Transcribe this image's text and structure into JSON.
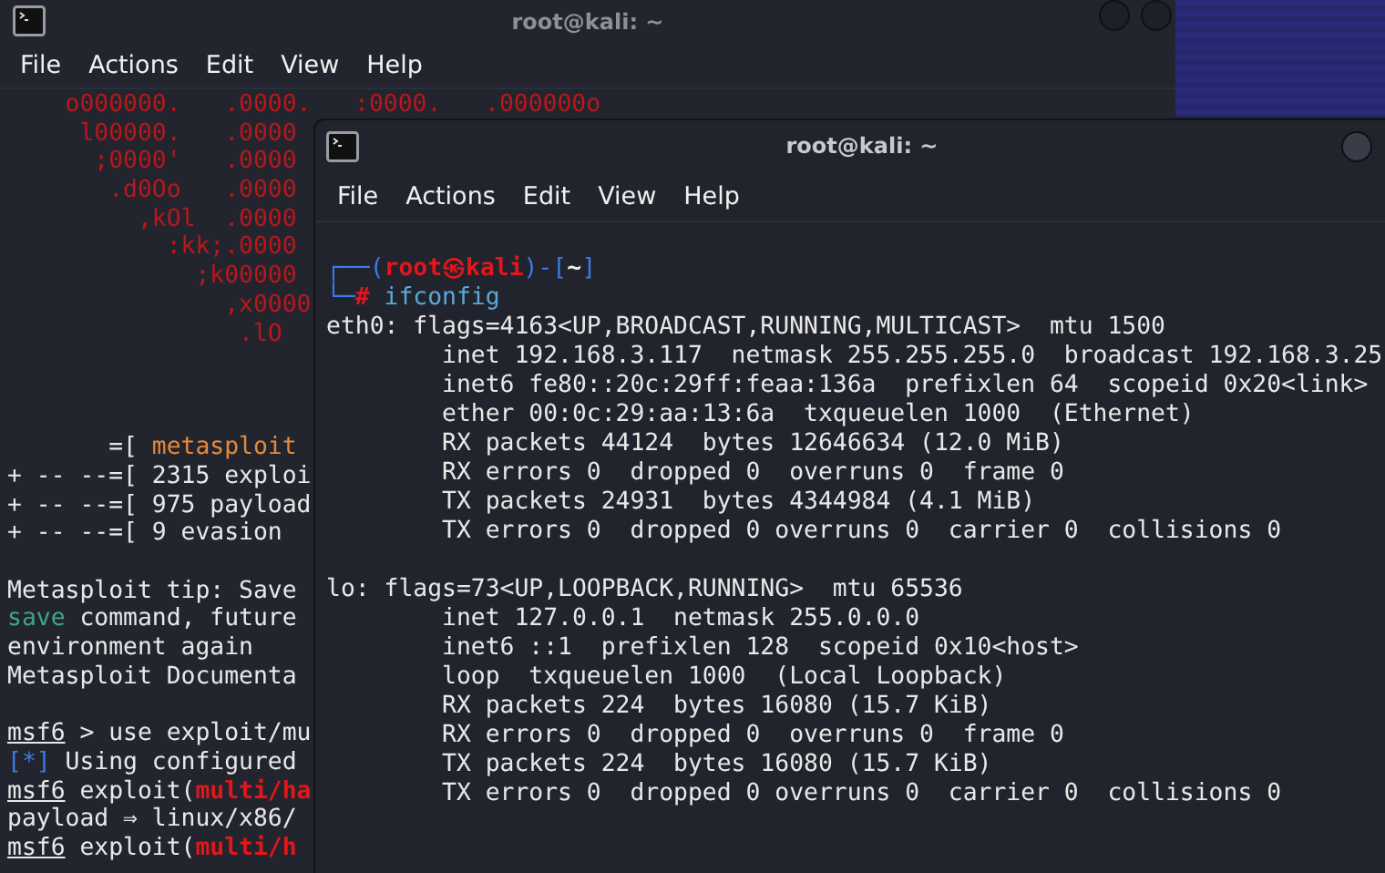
{
  "back_window": {
    "title": "root@kali: ~",
    "menu": [
      "File",
      "Actions",
      "Edit",
      "View",
      "Help"
    ],
    "lines": [
      {
        "kind": "text",
        "segments": [
          {
            "text": "    o000000.   .0000.   :0000.   .000000o",
            "kind": "logo"
          }
        ]
      },
      {
        "kind": "text",
        "segments": [
          {
            "text": "     l00000.   .0000",
            "kind": "logo"
          }
        ]
      },
      {
        "kind": "text",
        "segments": [
          {
            "text": "      ;0000'   .0000",
            "kind": "logo"
          }
        ]
      },
      {
        "kind": "text",
        "segments": [
          {
            "text": "       .d0Oo   .0000",
            "kind": "logo"
          }
        ]
      },
      {
        "kind": "text",
        "segments": [
          {
            "text": "         ,kOl  .0000",
            "kind": "logo"
          }
        ]
      },
      {
        "kind": "text",
        "segments": [
          {
            "text": "           :kk;.0000",
            "kind": "logo"
          }
        ]
      },
      {
        "kind": "text",
        "segments": [
          {
            "text": "             ;k00000",
            "kind": "logo"
          }
        ]
      },
      {
        "kind": "text",
        "segments": [
          {
            "text": "               ,x0000",
            "kind": "logo"
          }
        ]
      },
      {
        "kind": "text",
        "segments": [
          {
            "text": "                .lO",
            "kind": "logo"
          }
        ]
      },
      {
        "kind": "blank"
      },
      {
        "kind": "blank"
      },
      {
        "kind": "blank"
      },
      {
        "kind": "text",
        "segments": [
          {
            "text": "       =[ ",
            "kind": "plain"
          },
          {
            "text": "metasploit",
            "kind": "orange"
          }
        ]
      },
      {
        "kind": "text",
        "segments": [
          {
            "text": "+ -- --=[ 2315 exploi",
            "kind": "plain"
          }
        ]
      },
      {
        "kind": "text",
        "segments": [
          {
            "text": "+ -- --=[ 975 payload",
            "kind": "plain"
          }
        ]
      },
      {
        "kind": "text",
        "segments": [
          {
            "text": "+ -- --=[ 9 evasion",
            "kind": "plain"
          }
        ]
      },
      {
        "kind": "blank"
      },
      {
        "kind": "text",
        "segments": [
          {
            "text": "Metasploit tip: Save",
            "kind": "plain"
          }
        ]
      },
      {
        "kind": "text",
        "segments": [
          {
            "text": "save",
            "kind": "green"
          },
          {
            "text": " command, future",
            "kind": "plain"
          }
        ]
      },
      {
        "kind": "text",
        "segments": [
          {
            "text": "environment again",
            "kind": "plain"
          }
        ]
      },
      {
        "kind": "text",
        "segments": [
          {
            "text": "Metasploit Documenta",
            "kind": "plain"
          }
        ]
      },
      {
        "kind": "blank"
      },
      {
        "kind": "text",
        "segments": [
          {
            "text": "msf6",
            "kind": "underline"
          },
          {
            "text": " > use exploit/mu",
            "kind": "plain"
          }
        ]
      },
      {
        "kind": "text",
        "segments": [
          {
            "text": "[*]",
            "kind": "blue"
          },
          {
            "text": " Using configured",
            "kind": "plain"
          }
        ]
      },
      {
        "kind": "text",
        "segments": [
          {
            "text": "msf6",
            "kind": "underline"
          },
          {
            "text": " exploit(",
            "kind": "plain"
          },
          {
            "text": "multi/ha",
            "kind": "red-bold"
          }
        ]
      },
      {
        "kind": "text",
        "segments": [
          {
            "text": "payload ⇒ linux/x86/",
            "kind": "plain"
          }
        ]
      },
      {
        "kind": "text",
        "segments": [
          {
            "text": "msf6",
            "kind": "underline"
          },
          {
            "text": " exploit(",
            "kind": "plain"
          },
          {
            "text": "multi/h",
            "kind": "red-bold"
          }
        ]
      }
    ]
  },
  "front_window": {
    "title": "root@kali: ~",
    "menu": [
      "File",
      "Actions",
      "Edit",
      "View",
      "Help"
    ],
    "lines": [
      {
        "kind": "text",
        "segments": [
          {
            "text": "┌──(",
            "kind": "blue"
          },
          {
            "text": "root㉿kali",
            "kind": "red-bold"
          },
          {
            "text": ")-[",
            "kind": "blue"
          },
          {
            "text": "~",
            "kind": "white-bold"
          },
          {
            "text": "]",
            "kind": "blue"
          }
        ]
      },
      {
        "kind": "text",
        "segments": [
          {
            "text": "└─",
            "kind": "blue"
          },
          {
            "text": "#",
            "kind": "red-bold"
          },
          {
            "text": " ifconfig",
            "kind": "cyan"
          }
        ]
      },
      {
        "kind": "text",
        "segments": [
          {
            "text": "eth0: flags=4163<UP,BROADCAST,RUNNING,MULTICAST>  mtu 1500",
            "kind": "plain"
          }
        ]
      },
      {
        "kind": "text",
        "segments": [
          {
            "text": "        inet 192.168.3.117  netmask 255.255.255.0  broadcast 192.168.3.25",
            "kind": "plain"
          }
        ]
      },
      {
        "kind": "text",
        "segments": [
          {
            "text": "        inet6 fe80::20c:29ff:feaa:136a  prefixlen 64  scopeid 0x20<link>",
            "kind": "plain"
          }
        ]
      },
      {
        "kind": "text",
        "segments": [
          {
            "text": "        ether 00:0c:29:aa:13:6a  txqueuelen 1000  (Ethernet)",
            "kind": "plain"
          }
        ]
      },
      {
        "kind": "text",
        "segments": [
          {
            "text": "        RX packets 44124  bytes 12646634 (12.0 MiB)",
            "kind": "plain"
          }
        ]
      },
      {
        "kind": "text",
        "segments": [
          {
            "text": "        RX errors 0  dropped 0  overruns 0  frame 0",
            "kind": "plain"
          }
        ]
      },
      {
        "kind": "text",
        "segments": [
          {
            "text": "        TX packets 24931  bytes 4344984 (4.1 MiB)",
            "kind": "plain"
          }
        ]
      },
      {
        "kind": "text",
        "segments": [
          {
            "text": "        TX errors 0  dropped 0 overruns 0  carrier 0  collisions 0",
            "kind": "plain"
          }
        ]
      },
      {
        "kind": "blank"
      },
      {
        "kind": "text",
        "segments": [
          {
            "text": "lo: flags=73<UP,LOOPBACK,RUNNING>  mtu 65536",
            "kind": "plain"
          }
        ]
      },
      {
        "kind": "text",
        "segments": [
          {
            "text": "        inet 127.0.0.1  netmask 255.0.0.0",
            "kind": "plain"
          }
        ]
      },
      {
        "kind": "text",
        "segments": [
          {
            "text": "        inet6 ::1  prefixlen 128  scopeid 0x10<host>",
            "kind": "plain"
          }
        ]
      },
      {
        "kind": "text",
        "segments": [
          {
            "text": "        loop  txqueuelen 1000  (Local Loopback)",
            "kind": "plain"
          }
        ]
      },
      {
        "kind": "text",
        "segments": [
          {
            "text": "        RX packets 224  bytes 16080 (15.7 KiB)",
            "kind": "plain"
          }
        ]
      },
      {
        "kind": "text",
        "segments": [
          {
            "text": "        RX errors 0  dropped 0  overruns 0  frame 0",
            "kind": "plain"
          }
        ]
      },
      {
        "kind": "text",
        "segments": [
          {
            "text": "        TX packets 224  bytes 16080 (15.7 KiB)",
            "kind": "plain"
          }
        ]
      },
      {
        "kind": "text",
        "segments": [
          {
            "text": "        TX errors 0  dropped 0 overruns 0  carrier 0  collisions 0",
            "kind": "plain"
          }
        ]
      }
    ]
  }
}
